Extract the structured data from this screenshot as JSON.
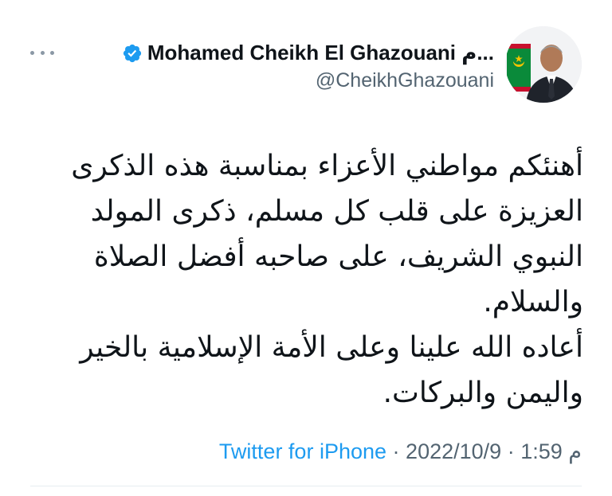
{
  "tweet": {
    "author": {
      "display_name": "Mohamed Cheikh El Ghazouani م...",
      "handle": "@CheikhGhazouani",
      "verified_icon": "verified-badge-icon",
      "avatar_icon": "profile-avatar"
    },
    "more_icon": "more-options-icon",
    "text_lines": [
      "أهنئكم مواطني الأعزاء بمناسبة هذه الذكرى",
      "العزيزة على قلب كل مسلم، ذكرى المولد",
      "النبوي الشريف، على صاحبه أفضل الصلاة",
      "والسلام.",
      "أعاده الله علينا وعلى الأمة الإسلامية بالخير",
      "واليمن والبركات."
    ],
    "meta": {
      "date": "2022/10/9",
      "time": "1:59",
      "am_pm": "م",
      "separator": "·",
      "source": "Twitter for iPhone"
    },
    "colors": {
      "link_blue": "#1d9bf0",
      "text": "#0f1419",
      "secondary": "#536471",
      "verified_blue": "#1d9bf0"
    }
  }
}
